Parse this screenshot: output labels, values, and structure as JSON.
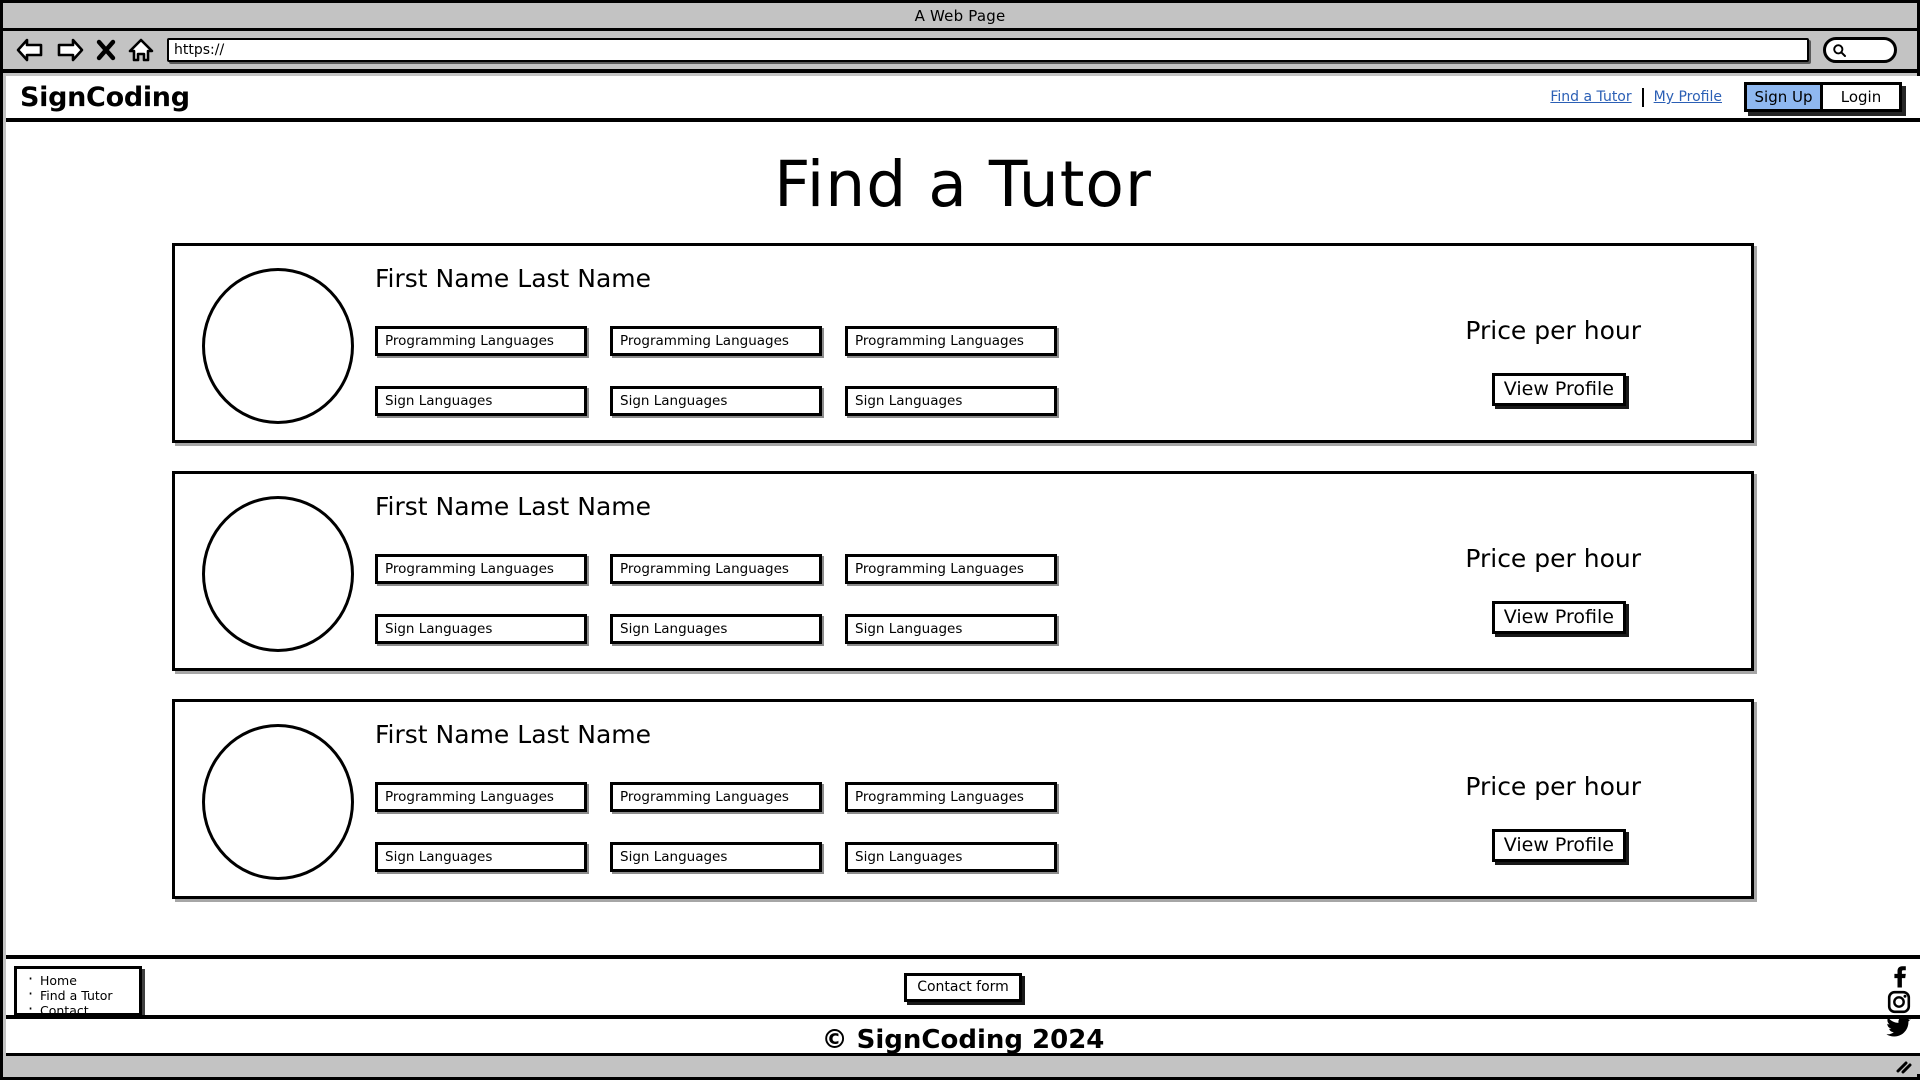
{
  "browser": {
    "window_title": "A Web Page",
    "back_icon": "back-arrow-icon",
    "forward_icon": "forward-arrow-icon",
    "stop_icon": "close-x-icon",
    "home_icon": "home-icon",
    "url_value": "https://",
    "search_icon": "search-icon",
    "resize_grip_icon": "resize-grip-icon"
  },
  "header": {
    "logo": "SignCoding",
    "links": [
      {
        "label": "Find a Tutor"
      },
      {
        "label": "My Profile"
      }
    ],
    "sign_up_label": "Sign Up",
    "login_label": "Login",
    "sign_up_color": "#8fb8f0",
    "link_color": "#2b5fb5"
  },
  "main": {
    "title": "Find a Tutor",
    "cards": [
      {
        "name": "First Name Last Name",
        "avatar": "avatar-placeholder",
        "tags_row1": [
          "Programming Languages",
          "Programming Languages",
          "Programming Languages"
        ],
        "tags_row2": [
          "Sign Languages",
          "Sign Languages",
          "Sign Languages"
        ],
        "price": "Price per hour",
        "view_profile_label": "View Profile"
      },
      {
        "name": "First Name Last Name",
        "avatar": "avatar-placeholder",
        "tags_row1": [
          "Programming Languages",
          "Programming Languages",
          "Programming Languages"
        ],
        "tags_row2": [
          "Sign Languages",
          "Sign Languages",
          "Sign Languages"
        ],
        "price": "Price per hour",
        "view_profile_label": "View Profile"
      },
      {
        "name": "First Name Last Name",
        "avatar": "avatar-placeholder",
        "tags_row1": [
          "Programming Languages",
          "Programming Languages",
          "Programming Languages"
        ],
        "tags_row2": [
          "Sign Languages",
          "Sign Languages",
          "Sign Languages"
        ],
        "price": "Price per hour",
        "view_profile_label": "View Profile"
      }
    ]
  },
  "footer": {
    "nav_items": [
      {
        "label": "Home"
      },
      {
        "label": "Find a Tutor"
      },
      {
        "label": "Contact"
      }
    ],
    "contact_form_label": "Contact form",
    "socials": [
      {
        "name": "facebook-icon"
      },
      {
        "name": "instagram-icon"
      },
      {
        "name": "twitter-icon"
      }
    ],
    "copyright": "© SignCoding 2024"
  }
}
